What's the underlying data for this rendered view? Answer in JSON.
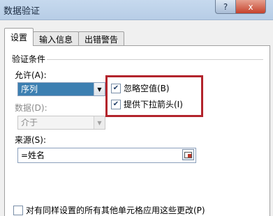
{
  "window": {
    "title": "数据验证",
    "help_label": "?",
    "close_label": "x"
  },
  "tabs": [
    {
      "label": "设置",
      "active": true
    },
    {
      "label": "输入信息",
      "active": false
    },
    {
      "label": "出错警告",
      "active": false
    }
  ],
  "settings": {
    "section_title": "验证条件",
    "allow": {
      "label": "允许(A):",
      "value": "序列"
    },
    "data": {
      "label": "数据(D):",
      "value": "介于",
      "disabled": true
    },
    "ignore_blank": {
      "label": "忽略空值(B)",
      "checked": true
    },
    "in_cell_dropdown": {
      "label": "提供下拉箭头(I)",
      "checked": true
    },
    "source": {
      "label": "来源(S):",
      "value": "=姓名"
    },
    "apply_all": {
      "label": "对有同样设置的所有其他单元格应用这些更改(P)",
      "checked": false
    }
  },
  "icons": {
    "combo_arrow": "chevron-down-icon",
    "checkmark": "check-icon",
    "range_select": "range-select-icon"
  },
  "colors": {
    "highlight_border": "#b3242c",
    "selection": "#3c7fb1"
  }
}
